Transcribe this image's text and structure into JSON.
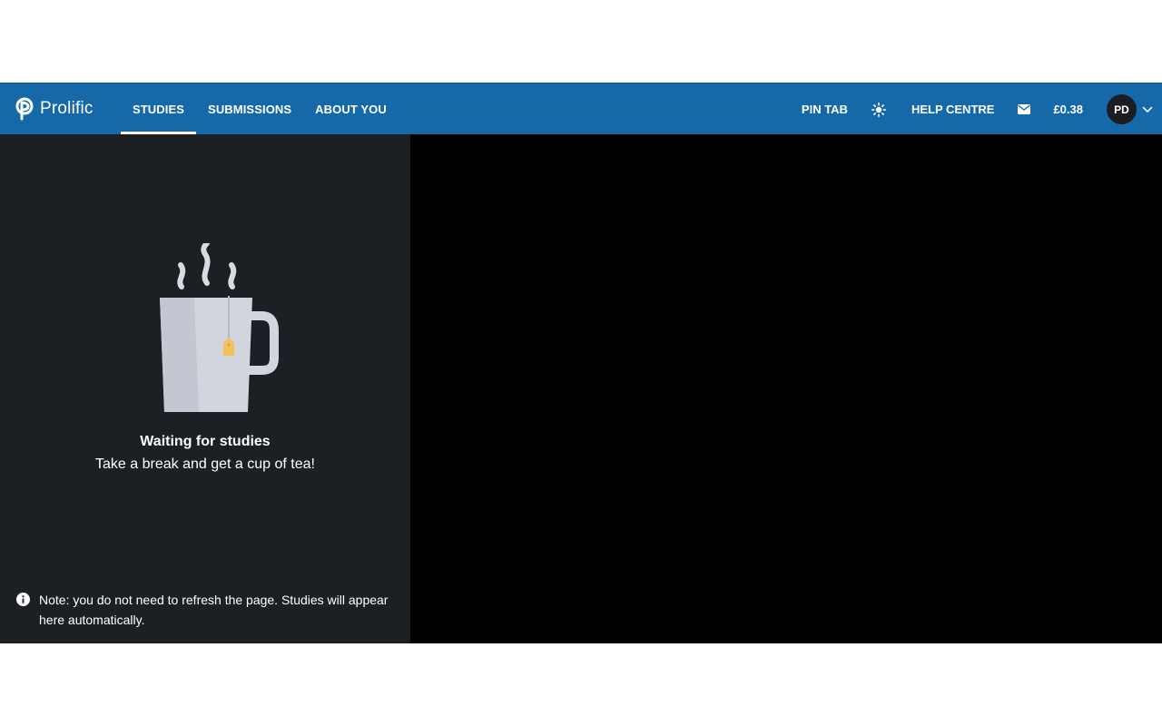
{
  "header": {
    "logo_text": "Prolific",
    "nav": [
      {
        "label": "STUDIES",
        "active": true
      },
      {
        "label": "SUBMISSIONS",
        "active": false
      },
      {
        "label": "ABOUT YOU",
        "active": false
      }
    ],
    "pin_tab_label": "PIN TAB",
    "theme_icon": "sun-icon",
    "help_label": "HELP CENTRE",
    "messages_icon": "envelope-icon",
    "balance": "£0.38",
    "avatar_initials": "PD",
    "menu_icon": "chevron-down-icon"
  },
  "studies": {
    "empty_title": "Waiting for studies",
    "empty_subtitle": "Take a break and get a cup of tea!",
    "note": "Note: you do not need to refresh the page. Studies will appear here automatically.",
    "illustration_icon": "tea-mug-icon",
    "note_icon": "info-icon"
  },
  "colors": {
    "header_bg": "#1669a9",
    "panel_bg": "#1c1f24",
    "content_bg": "#000000"
  }
}
